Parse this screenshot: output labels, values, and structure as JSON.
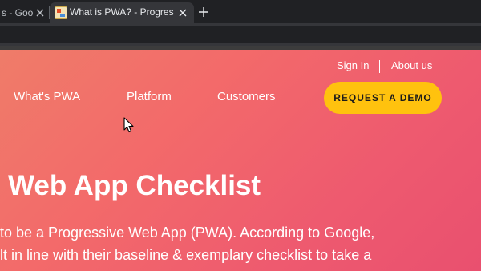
{
  "browser": {
    "tabs": [
      {
        "title": "s - Goo",
        "active": false
      },
      {
        "title": "What is PWA? - Progressive",
        "active": true
      }
    ]
  },
  "site": {
    "utility_nav": {
      "sign_in": "Sign In",
      "about": "About us"
    },
    "main_nav": {
      "pwa": "What's PWA",
      "platform": "Platform",
      "customers": "Customers"
    },
    "cta_label": "REQUEST A DEMO",
    "hero": {
      "title": "Web App Checklist",
      "line1": "to be a Progressive Web App (PWA). According to Google,",
      "line2": "lt in line with their baseline & exemplary checklist to take a"
    }
  },
  "colors": {
    "page_gradient_start": "#ef7c69",
    "page_gradient_end": "#e9506f",
    "cta_background": "#ffc20e"
  }
}
